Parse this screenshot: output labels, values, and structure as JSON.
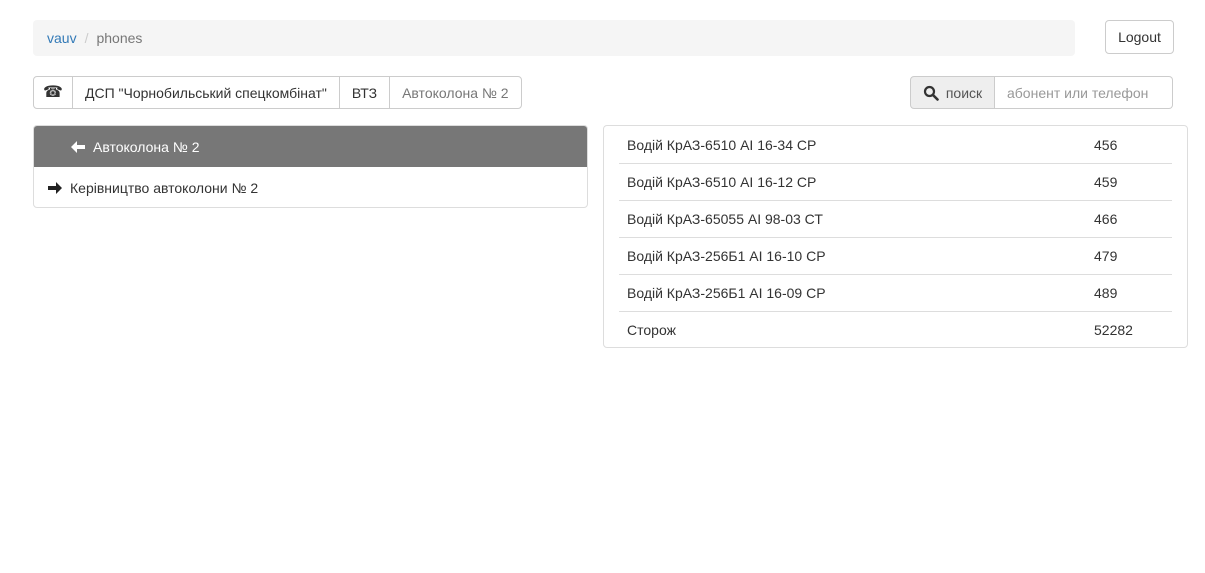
{
  "breadcrumb": {
    "root": "vauv",
    "separator": "/",
    "current": "phones"
  },
  "header": {
    "logout_label": "Logout"
  },
  "path": {
    "home_icon": "telephone-icon",
    "items": [
      "ДСП \"Чорнобильський спецкомбінат\"",
      "ВТЗ",
      "Автоколона № 2"
    ]
  },
  "search": {
    "button_label": "поиск",
    "placeholder": "абонент или телефон",
    "value": "",
    "icon": "search-icon"
  },
  "tree": {
    "back_label": "Автоколона № 2",
    "back_icon": "arrow-left-icon",
    "children": [
      {
        "label": "Керівництво автоколони № 2",
        "icon": "arrow-right-icon"
      }
    ]
  },
  "phones": [
    {
      "name": "Водій КрАЗ-6510 АІ 16-34 СР",
      "phone": "456"
    },
    {
      "name": "Водій КрАЗ-6510 АІ 16-12 СР",
      "phone": "459"
    },
    {
      "name": "Водій КрАЗ-65055 АІ 98-03 СТ",
      "phone": "466"
    },
    {
      "name": "Водій КрАЗ-256Б1 АІ 16-10 СР",
      "phone": "479"
    },
    {
      "name": "Водій КрАЗ-256Б1 АІ 16-09 СР",
      "phone": "489"
    },
    {
      "name": "Сторож",
      "phone": "52282"
    }
  ],
  "colors": {
    "link": "#337ab7",
    "header_bg": "#777777",
    "border": "#dddddd",
    "breadcrumb_bg": "#f5f5f5"
  }
}
